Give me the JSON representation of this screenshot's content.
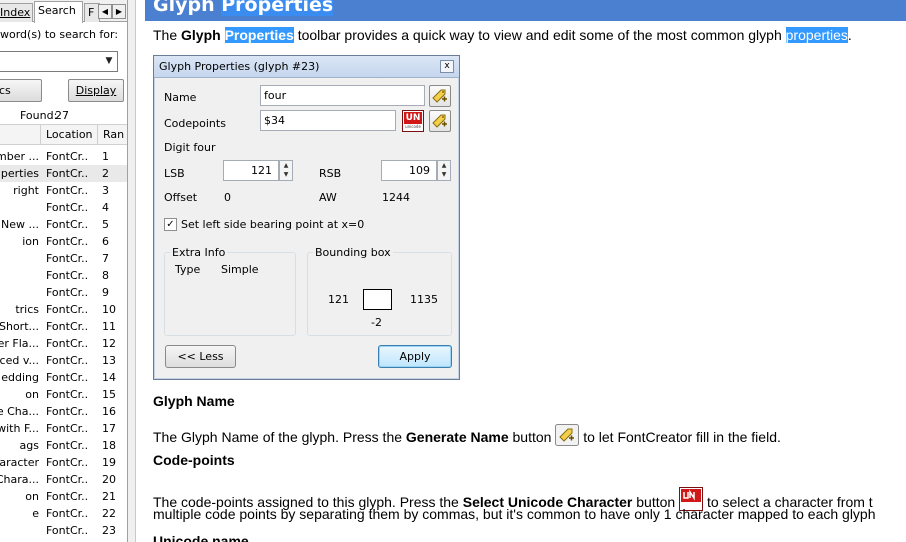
{
  "left_pane": {
    "tabs": {
      "index": "Index",
      "search": "Search",
      "third": "F"
    },
    "search_label": "word(s) to search for:",
    "search_value": "",
    "list_topics_button": "cs",
    "display_button": "Display",
    "found_label": "Found:",
    "found_count": "27",
    "results_columns": {
      "location": "Location",
      "rank": "Ran"
    },
    "results": [
      {
        "title": "mber ...",
        "location": "FontCr...",
        "rank": "1"
      },
      {
        "title": "perties",
        "location": "FontCr...",
        "rank": "2"
      },
      {
        "title": "right",
        "location": "FontCr...",
        "rank": "3"
      },
      {
        "title": "",
        "location": "FontCr...",
        "rank": "4"
      },
      {
        "title": "New ...",
        "location": "FontCr...",
        "rank": "5"
      },
      {
        "title": "ion",
        "location": "FontCr...",
        "rank": "6"
      },
      {
        "title": "",
        "location": "FontCr...",
        "rank": "7"
      },
      {
        "title": "",
        "location": "FontCr...",
        "rank": "8"
      },
      {
        "title": "",
        "location": "FontCr...",
        "rank": "9"
      },
      {
        "title": "trics",
        "location": "FontCr...",
        "rank": "10"
      },
      {
        "title": "Short...",
        "location": "FontCr...",
        "rank": "11"
      },
      {
        "title": "der Fla...",
        "location": "FontCr...",
        "rank": "12"
      },
      {
        "title": "ced v...",
        "location": "FontCr...",
        "rank": "13"
      },
      {
        "title": "edding",
        "location": "FontCr...",
        "rank": "14"
      },
      {
        "title": "on",
        "location": "FontCr...",
        "rank": "15"
      },
      {
        "title": "e Cha...",
        "location": "FontCr...",
        "rank": "16"
      },
      {
        "title": "with F...",
        "location": "FontCr...",
        "rank": "17"
      },
      {
        "title": "ags",
        "location": "FontCr...",
        "rank": "18"
      },
      {
        "title": "haracter",
        "location": "FontCr...",
        "rank": "19"
      },
      {
        "title": "Chara...",
        "location": "FontCr...",
        "rank": "20"
      },
      {
        "title": "on",
        "location": "FontCr...",
        "rank": "21"
      },
      {
        "title": "e",
        "location": "FontCr...",
        "rank": "22"
      },
      {
        "title": "",
        "location": "FontCr...",
        "rank": "23"
      }
    ]
  },
  "topic": {
    "title_word1": "Glyph",
    "title_word2": "Properties",
    "intro_the": "The ",
    "intro_bold": "Glyph",
    "intro_hl": "Properties",
    "intro_rest": " toolbar provides a quick way to view and edit some of the most common glyph ",
    "intro_hl2": "properties",
    "intro_end": ".",
    "h_glyph_name": "Glyph Name",
    "p_glyph_name_1": "The Glyph Name of the glyph. Press the ",
    "p_glyph_name_bold": "Generate Name",
    "p_glyph_name_2": " button ",
    "p_glyph_name_3": " to let FontCreator fill in the field.",
    "h_codepoints": "Code-points",
    "p_codepoints_1": "The code-points assigned to this glyph. Press the ",
    "p_codepoints_bold": "Select Unicode Character",
    "p_codepoints_2": " button ",
    "p_codepoints_3": " to select a character from t",
    "p_codepoints_line2": "multiple code points by separating them by commas, but it's common to have only 1  character mapped to each glyph",
    "h_unicode_name": "Unicode name"
  },
  "dialog": {
    "title": "Glyph Properties (glyph #23)",
    "close_glyph": "x",
    "name_label": "Name",
    "name_value": "four",
    "codepoints_label": "Codepoints",
    "codepoints_value": "$34",
    "unicode_btn_top": "UN",
    "unicode_btn_bottom": "unicode",
    "unicode_name": "Digit four",
    "lsb_label": "LSB",
    "lsb_value": "121",
    "rsb_label": "RSB",
    "rsb_value": "109",
    "offset_label": "Offset",
    "offset_value": "0",
    "aw_label": "AW",
    "aw_value": "1244",
    "checkbox_label": "Set left side bearing point at x=0",
    "checkbox_mark": "✓",
    "extra_info_label": "Extra Info",
    "type_label": "Type",
    "type_value": "Simple",
    "bbox_label": "Bounding box",
    "bbox_left": "121",
    "bbox_right": "1135",
    "bbox_bottom": "-2",
    "less_button": "<< Less",
    "apply_button": "Apply"
  }
}
